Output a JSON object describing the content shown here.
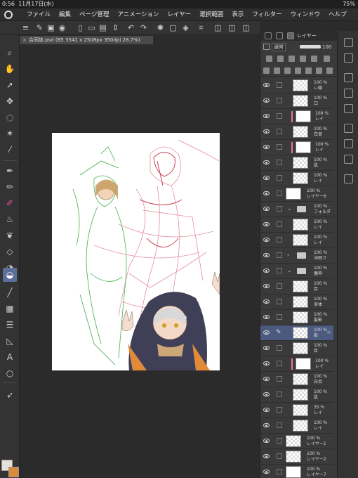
{
  "status": {
    "time": "0:56",
    "date": "11月17日(水)",
    "battery": "75%"
  },
  "menu": {
    "items": [
      "ファイル",
      "編集",
      "ページ管理",
      "アニメーション",
      "レイヤー",
      "選択範囲",
      "表示",
      "フィルター",
      "ウィンドウ",
      "ヘルプ"
    ]
  },
  "document": {
    "tab_title": "合同誌.psd (B5 3541 x 2508px 350dpi 28.7%)"
  },
  "layer_panel": {
    "title": "レイヤー",
    "blend_mode": "通常",
    "opacity": "100",
    "layers": [
      {
        "opacity": "100 %",
        "name": "レ線",
        "type": "layer"
      },
      {
        "opacity": "100 %",
        "name": "口",
        "type": "layer"
      },
      {
        "opacity": "100 %",
        "name": "レイ",
        "type": "layer"
      },
      {
        "opacity": "100 %",
        "name": "白目",
        "type": "layer"
      },
      {
        "opacity": "100 %",
        "name": "レイ",
        "type": "layer"
      },
      {
        "opacity": "100 %",
        "name": "肌",
        "type": "layer"
      },
      {
        "opacity": "100 %",
        "name": "レイ",
        "type": "layer"
      },
      {
        "opacity": "100 %",
        "name": "レイヤー6",
        "type": "layer"
      },
      {
        "opacity": "100 %",
        "name": "フォルダ",
        "type": "folder"
      },
      {
        "opacity": "100 %",
        "name": "レイ",
        "type": "layer"
      },
      {
        "opacity": "100 %",
        "name": "レイ",
        "type": "layer"
      },
      {
        "opacity": "100 %",
        "name": "沖田フ",
        "type": "folder"
      },
      {
        "opacity": "100 %",
        "name": "魔神",
        "type": "folder"
      },
      {
        "opacity": "100 %",
        "name": "目",
        "type": "layer"
      },
      {
        "opacity": "100 %",
        "name": "身体",
        "type": "layer"
      },
      {
        "opacity": "100 %",
        "name": "髪影",
        "type": "layer"
      },
      {
        "opacity": "100 %",
        "name": "影",
        "type": "layer"
      },
      {
        "opacity": "100 %",
        "name": "目",
        "type": "layer"
      },
      {
        "opacity": "100 %",
        "name": "レイ",
        "type": "layer"
      },
      {
        "opacity": "100 %",
        "name": "白目",
        "type": "layer"
      },
      {
        "opacity": "100 %",
        "name": "肌",
        "type": "layer"
      },
      {
        "opacity": "35 %",
        "name": "レイ",
        "type": "layer"
      },
      {
        "opacity": "100 %",
        "name": "レイ",
        "type": "layer"
      },
      {
        "opacity": "100 %",
        "name": "レイヤー1",
        "type": "layer"
      },
      {
        "opacity": "100 %",
        "name": "レイヤー2",
        "type": "layer"
      },
      {
        "opacity": "100 %",
        "name": "レイヤー7",
        "type": "layer"
      }
    ]
  },
  "colors": {
    "main": "#e7e1dc",
    "sub": "#d98a3d",
    "accent": "#5b6f9a"
  }
}
